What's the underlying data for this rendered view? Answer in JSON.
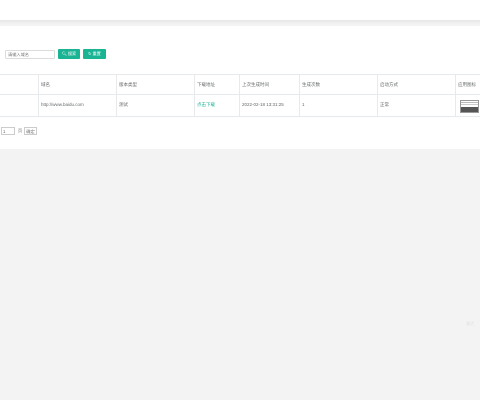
{
  "search": {
    "placeholder": "请输入域名",
    "search_label": "搜索",
    "reset_label": "重置",
    "search_icon": "search-icon",
    "reset_icon": "refresh-icon"
  },
  "table": {
    "columns": [
      "",
      "域名",
      "版本类型",
      "下载地址",
      "上次生成时间",
      "生成次数",
      "启动方式",
      "应用图标"
    ],
    "rows": [
      {
        "index": "",
        "domain": "http://www.baidu.com",
        "version_type": "测试",
        "download": "点击下载",
        "last_generated": "2022-02-18 13:31:25",
        "count": "1",
        "launch_mode": "正常"
      }
    ]
  },
  "pager": {
    "page_value": "1",
    "unit": "页",
    "jump_label": "确定"
  },
  "watermark": "激活"
}
